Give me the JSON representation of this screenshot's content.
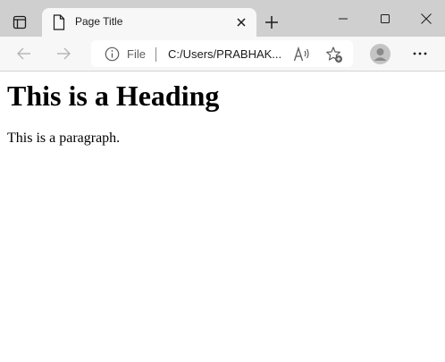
{
  "browser": {
    "tab": {
      "title": "Page Title",
      "icon": "document-icon"
    },
    "toolbar": {
      "scheme_label": "File",
      "url": "C:/Users/PRABHAK...",
      "icons": [
        "back-arrow-icon",
        "forward-arrow-icon",
        "info-icon",
        "read-aloud-icon",
        "add-favorite-icon",
        "profile-icon",
        "more-icon"
      ]
    },
    "window_controls": [
      "minimize-icon",
      "maximize-icon",
      "close-icon"
    ],
    "colors": {
      "tabstrip": "#cfcfcf",
      "toolbar": "#f7f7f7",
      "page": "#ffffff"
    }
  },
  "page": {
    "heading": "This is a Heading",
    "paragraph": "This is a paragraph."
  }
}
